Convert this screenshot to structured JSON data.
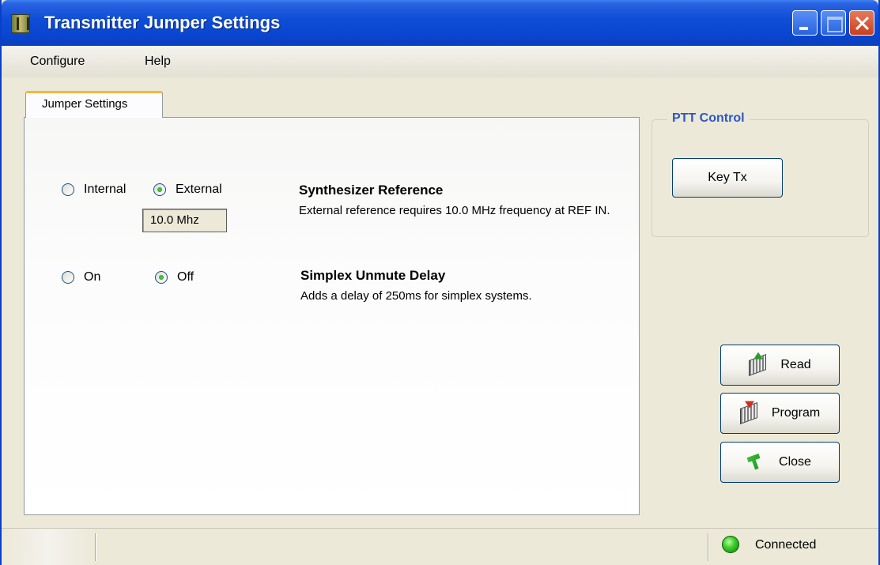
{
  "window": {
    "title": "Transmitter Jumper Settings"
  },
  "menu": {
    "items": [
      {
        "label": "Configure"
      },
      {
        "label": "Help"
      }
    ]
  },
  "tabs": [
    {
      "label": "Jumper Settings",
      "active": true
    }
  ],
  "synthesizer": {
    "options": [
      {
        "label": "Internal",
        "checked": false
      },
      {
        "label": "External",
        "checked": true
      }
    ],
    "frequency_value": "10.0 Mhz",
    "title": "Synthesizer Reference",
    "description": "External reference requires 10.0 MHz frequency at REF IN."
  },
  "simplex": {
    "options": [
      {
        "label": "On",
        "checked": false
      },
      {
        "label": "Off",
        "checked": true
      }
    ],
    "title": "Simplex Unmute Delay",
    "description": "Adds a delay of 250ms for simplex systems."
  },
  "ptt": {
    "group_title": "PTT Control",
    "key_button": "Key Tx"
  },
  "actions": {
    "read": "Read",
    "program": "Program",
    "close": "Close"
  },
  "status": {
    "connection": "Connected",
    "led_color": "#3fcf2a"
  }
}
